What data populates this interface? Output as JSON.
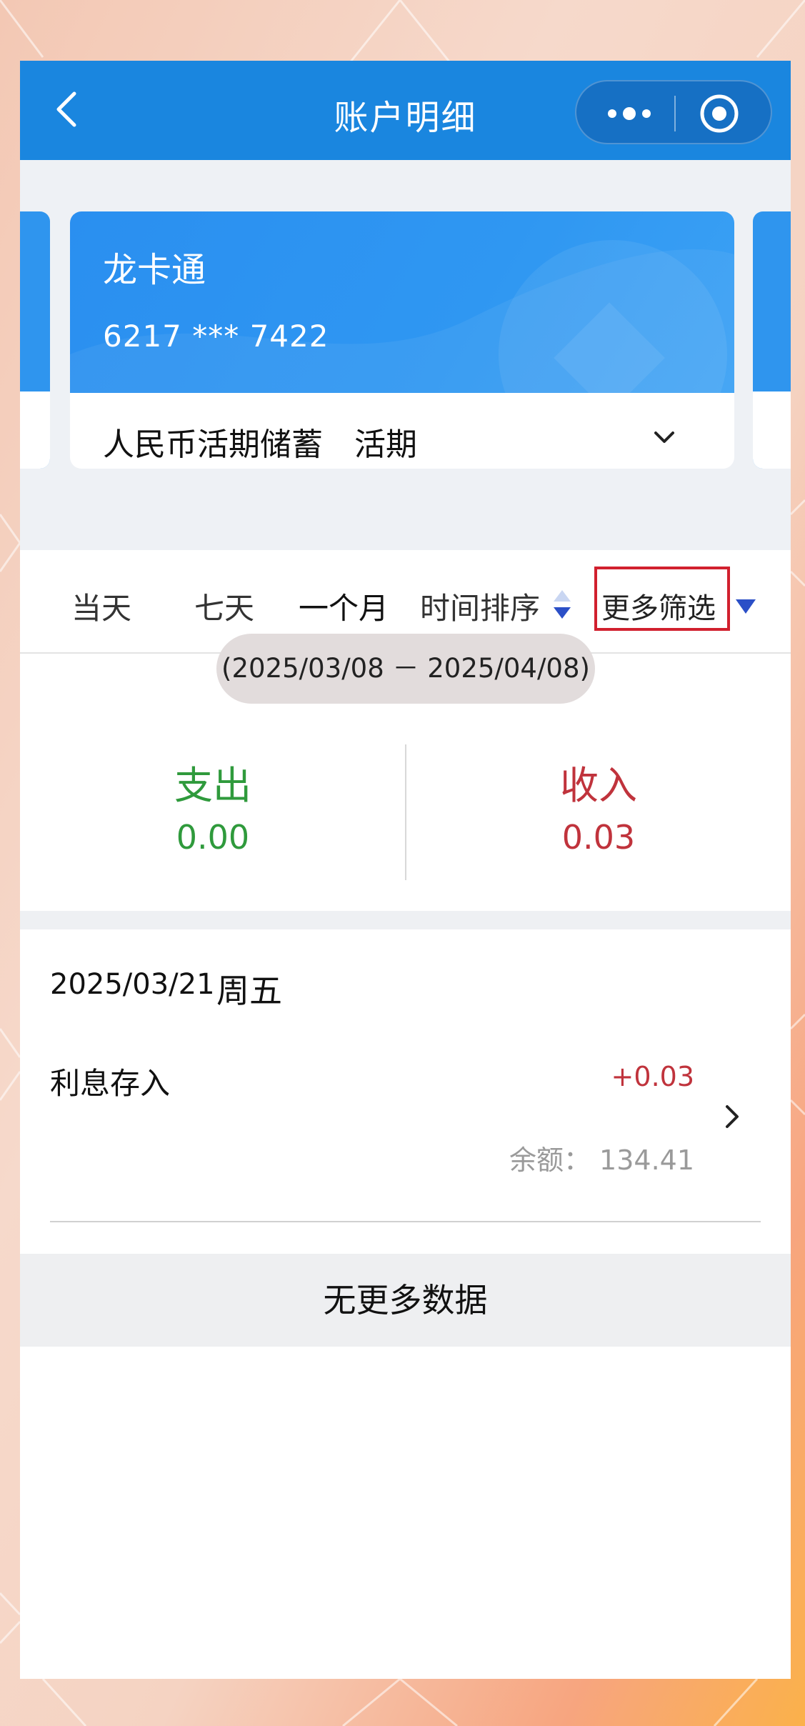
{
  "header": {
    "title": "账户明细"
  },
  "card": {
    "name": "龙卡通",
    "number": "6217 *** 7422",
    "account_type": "人民币活期储蓄　活期"
  },
  "tabs": [
    {
      "label": "当天",
      "active": false
    },
    {
      "label": "七天",
      "active": false
    },
    {
      "label": "一个月",
      "active": true
    },
    {
      "label": "时间排序",
      "active": false
    }
  ],
  "filter": {
    "label": "更多筛选"
  },
  "summary": {
    "date_range": "(2025/03/08 － 2025/04/08)",
    "expense_label": "支出",
    "expense_value": "0.00",
    "income_label": "收入",
    "income_value": "0.03"
  },
  "transactions": [
    {
      "date": "2025/03/21",
      "weekday": "周五",
      "title": "利息存入",
      "amount": "+0.03",
      "balance": "余额： 134.41"
    }
  ],
  "footer": {
    "no_more": "无更多数据"
  },
  "colors": {
    "brand_blue": "#1a86df",
    "expense_green": "#2f9a3c",
    "income_red": "#c0333c",
    "highlight_red": "#d1202e"
  }
}
